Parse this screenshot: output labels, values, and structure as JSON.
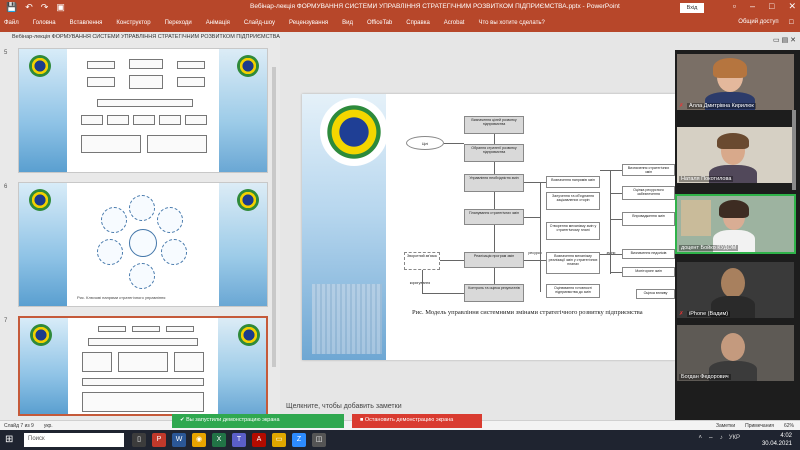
{
  "window": {
    "title": "Вебінар-лекція ФОРМУВАННЯ СИСТЕМИ УПРАВЛІННЯ СТРАТЕГІЧНИМ РОЗВИТКОМ ПІДПРИЄМСТВА.pptx - PowerPoint",
    "signin": "Вхід",
    "quick_access": [
      "💾",
      "↶",
      "↷",
      "▣"
    ]
  },
  "ribbon": {
    "tabs": [
      "Файл",
      "Головна",
      "Вставлення",
      "Конструктор",
      "Переходи",
      "Анімація",
      "Слайд-шоу",
      "Рецензування",
      "Вид",
      "OfficeTab",
      "Справка",
      "Acrobat",
      "Что вы хотите сделать?"
    ],
    "share_label": "Общий доступ"
  },
  "pane": {
    "doc_name": "Вебінар-лекція ФОРМУВАННЯ СИСТЕМИ УПРАВЛІННЯ СТРАТЕГІЧНИМ РОЗВИТКОМ ПІДПРИЄМСТВА.pptx",
    "slide_numbers": [
      "5",
      "6",
      "7"
    ],
    "slide6_caption": "Рис. Ключові напрями стратегічного управління"
  },
  "slide": {
    "nodes": {
      "n1": "Визначення цілей розвитку підприємства",
      "n2": "Цілі",
      "n3": "Обрання стратегії розвитку підприємства",
      "n4": "Управління необхідністю змін",
      "n5": "Планування стратегічних змін",
      "n6": "Реалізація програм змін",
      "n7": "Контроль та оцінка результатів",
      "n8": "Визначення напрямів змін",
      "n9": "Залучення та об'єднання зацікавлених сторін",
      "n10": "Створення механізму змін у стратегічному плані",
      "n11": "Визначення механізму реалізації змін у стратегічних планах",
      "n12": "Оцінювання готовності підприємства до змін",
      "n13": "Визначення стратегічних змін",
      "n14": "Оцінка ресурсного забезпечення",
      "n15": "Впровадження змін",
      "n16": "Визначення недоліків",
      "n17": "Моніторинг змін",
      "n18": "Оцінка впливу",
      "n19": "Зворотний зв'язок",
      "n20": "Контроль виконання завдань",
      "lbl_korig": "коригування",
      "lbl_resursy": "ресурси",
      "lbl_zminy": "зміни"
    },
    "caption": "Рис. Модель управління системними змінами стратегічного розвитку підприємства"
  },
  "notes_placeholder": "Щелкните, чтобы добавить заметки",
  "video": {
    "participants": [
      {
        "name": "Алла Дмитрівна Кирилюк",
        "muted": true
      },
      {
        "name": "Наталя Покотилова",
        "muted": false
      },
      {
        "name": "доцент Бойко КУДОМ",
        "muted": false
      },
      {
        "name": "iPhone (Вадим)",
        "muted": true
      },
      {
        "name": "Богдан Федорович",
        "muted": false
      }
    ],
    "top_icons": "▭ ▤ ✕"
  },
  "share": {
    "sharing_text": "Вы запустили демонстрацию экрана",
    "stop_text": "Остановить демонстрацию экрана"
  },
  "status": {
    "slide_info": "Слайд 7 из 9",
    "lang": "укр.",
    "notes": "Заметки",
    "comments": "Примечания",
    "zoom": "62%"
  },
  "taskbar": {
    "search_placeholder": "Поиск",
    "time": "4:02",
    "date": "30.04.2021",
    "lang": "УКР"
  }
}
